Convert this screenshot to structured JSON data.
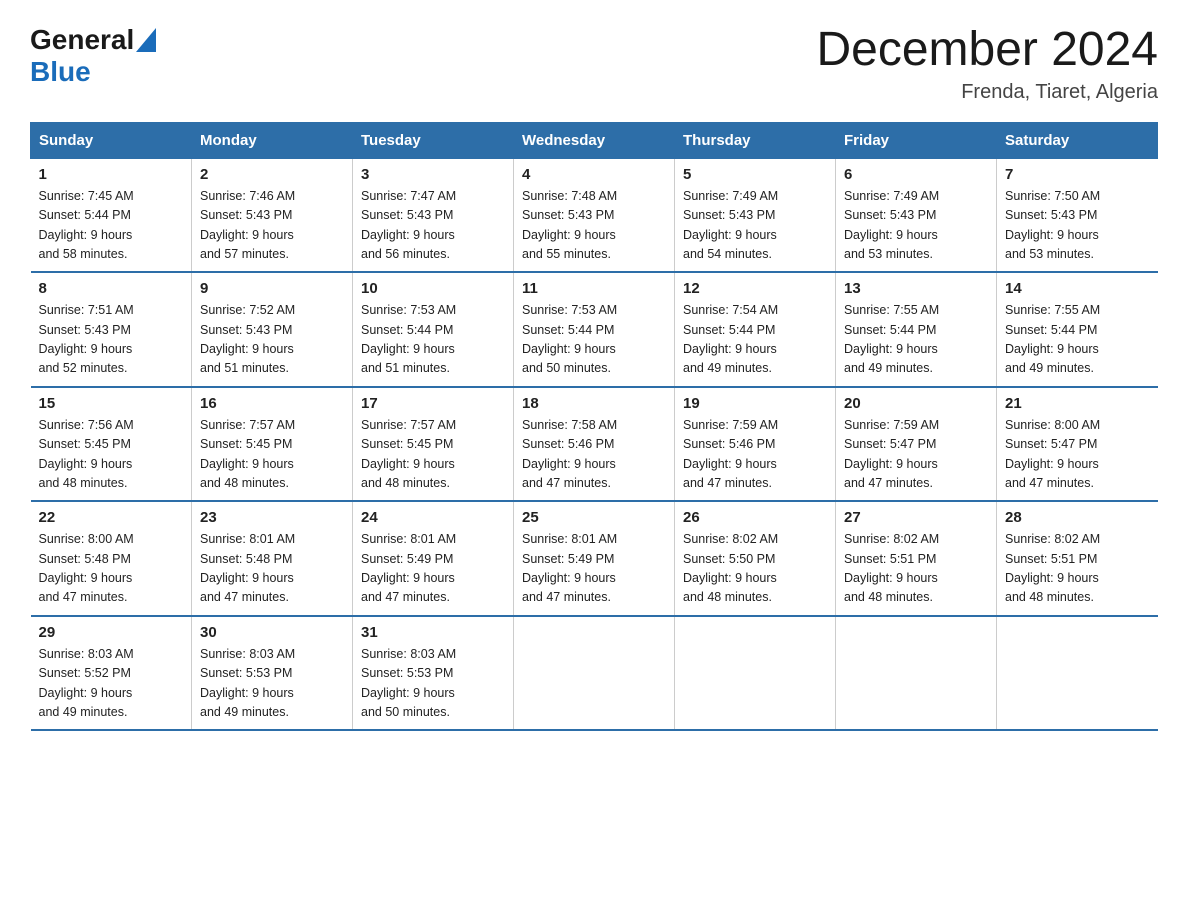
{
  "header": {
    "logo_general": "General",
    "logo_blue": "Blue",
    "month_title": "December 2024",
    "location": "Frenda, Tiaret, Algeria"
  },
  "days_of_week": [
    "Sunday",
    "Monday",
    "Tuesday",
    "Wednesday",
    "Thursday",
    "Friday",
    "Saturday"
  ],
  "weeks": [
    [
      {
        "day": "1",
        "sunrise": "Sunrise: 7:45 AM",
        "sunset": "Sunset: 5:44 PM",
        "daylight": "Daylight: 9 hours",
        "daylight2": "and 58 minutes."
      },
      {
        "day": "2",
        "sunrise": "Sunrise: 7:46 AM",
        "sunset": "Sunset: 5:43 PM",
        "daylight": "Daylight: 9 hours",
        "daylight2": "and 57 minutes."
      },
      {
        "day": "3",
        "sunrise": "Sunrise: 7:47 AM",
        "sunset": "Sunset: 5:43 PM",
        "daylight": "Daylight: 9 hours",
        "daylight2": "and 56 minutes."
      },
      {
        "day": "4",
        "sunrise": "Sunrise: 7:48 AM",
        "sunset": "Sunset: 5:43 PM",
        "daylight": "Daylight: 9 hours",
        "daylight2": "and 55 minutes."
      },
      {
        "day": "5",
        "sunrise": "Sunrise: 7:49 AM",
        "sunset": "Sunset: 5:43 PM",
        "daylight": "Daylight: 9 hours",
        "daylight2": "and 54 minutes."
      },
      {
        "day": "6",
        "sunrise": "Sunrise: 7:49 AM",
        "sunset": "Sunset: 5:43 PM",
        "daylight": "Daylight: 9 hours",
        "daylight2": "and 53 minutes."
      },
      {
        "day": "7",
        "sunrise": "Sunrise: 7:50 AM",
        "sunset": "Sunset: 5:43 PM",
        "daylight": "Daylight: 9 hours",
        "daylight2": "and 53 minutes."
      }
    ],
    [
      {
        "day": "8",
        "sunrise": "Sunrise: 7:51 AM",
        "sunset": "Sunset: 5:43 PM",
        "daylight": "Daylight: 9 hours",
        "daylight2": "and 52 minutes."
      },
      {
        "day": "9",
        "sunrise": "Sunrise: 7:52 AM",
        "sunset": "Sunset: 5:43 PM",
        "daylight": "Daylight: 9 hours",
        "daylight2": "and 51 minutes."
      },
      {
        "day": "10",
        "sunrise": "Sunrise: 7:53 AM",
        "sunset": "Sunset: 5:44 PM",
        "daylight": "Daylight: 9 hours",
        "daylight2": "and 51 minutes."
      },
      {
        "day": "11",
        "sunrise": "Sunrise: 7:53 AM",
        "sunset": "Sunset: 5:44 PM",
        "daylight": "Daylight: 9 hours",
        "daylight2": "and 50 minutes."
      },
      {
        "day": "12",
        "sunrise": "Sunrise: 7:54 AM",
        "sunset": "Sunset: 5:44 PM",
        "daylight": "Daylight: 9 hours",
        "daylight2": "and 49 minutes."
      },
      {
        "day": "13",
        "sunrise": "Sunrise: 7:55 AM",
        "sunset": "Sunset: 5:44 PM",
        "daylight": "Daylight: 9 hours",
        "daylight2": "and 49 minutes."
      },
      {
        "day": "14",
        "sunrise": "Sunrise: 7:55 AM",
        "sunset": "Sunset: 5:44 PM",
        "daylight": "Daylight: 9 hours",
        "daylight2": "and 49 minutes."
      }
    ],
    [
      {
        "day": "15",
        "sunrise": "Sunrise: 7:56 AM",
        "sunset": "Sunset: 5:45 PM",
        "daylight": "Daylight: 9 hours",
        "daylight2": "and 48 minutes."
      },
      {
        "day": "16",
        "sunrise": "Sunrise: 7:57 AM",
        "sunset": "Sunset: 5:45 PM",
        "daylight": "Daylight: 9 hours",
        "daylight2": "and 48 minutes."
      },
      {
        "day": "17",
        "sunrise": "Sunrise: 7:57 AM",
        "sunset": "Sunset: 5:45 PM",
        "daylight": "Daylight: 9 hours",
        "daylight2": "and 48 minutes."
      },
      {
        "day": "18",
        "sunrise": "Sunrise: 7:58 AM",
        "sunset": "Sunset: 5:46 PM",
        "daylight": "Daylight: 9 hours",
        "daylight2": "and 47 minutes."
      },
      {
        "day": "19",
        "sunrise": "Sunrise: 7:59 AM",
        "sunset": "Sunset: 5:46 PM",
        "daylight": "Daylight: 9 hours",
        "daylight2": "and 47 minutes."
      },
      {
        "day": "20",
        "sunrise": "Sunrise: 7:59 AM",
        "sunset": "Sunset: 5:47 PM",
        "daylight": "Daylight: 9 hours",
        "daylight2": "and 47 minutes."
      },
      {
        "day": "21",
        "sunrise": "Sunrise: 8:00 AM",
        "sunset": "Sunset: 5:47 PM",
        "daylight": "Daylight: 9 hours",
        "daylight2": "and 47 minutes."
      }
    ],
    [
      {
        "day": "22",
        "sunrise": "Sunrise: 8:00 AM",
        "sunset": "Sunset: 5:48 PM",
        "daylight": "Daylight: 9 hours",
        "daylight2": "and 47 minutes."
      },
      {
        "day": "23",
        "sunrise": "Sunrise: 8:01 AM",
        "sunset": "Sunset: 5:48 PM",
        "daylight": "Daylight: 9 hours",
        "daylight2": "and 47 minutes."
      },
      {
        "day": "24",
        "sunrise": "Sunrise: 8:01 AM",
        "sunset": "Sunset: 5:49 PM",
        "daylight": "Daylight: 9 hours",
        "daylight2": "and 47 minutes."
      },
      {
        "day": "25",
        "sunrise": "Sunrise: 8:01 AM",
        "sunset": "Sunset: 5:49 PM",
        "daylight": "Daylight: 9 hours",
        "daylight2": "and 47 minutes."
      },
      {
        "day": "26",
        "sunrise": "Sunrise: 8:02 AM",
        "sunset": "Sunset: 5:50 PM",
        "daylight": "Daylight: 9 hours",
        "daylight2": "and 48 minutes."
      },
      {
        "day": "27",
        "sunrise": "Sunrise: 8:02 AM",
        "sunset": "Sunset: 5:51 PM",
        "daylight": "Daylight: 9 hours",
        "daylight2": "and 48 minutes."
      },
      {
        "day": "28",
        "sunrise": "Sunrise: 8:02 AM",
        "sunset": "Sunset: 5:51 PM",
        "daylight": "Daylight: 9 hours",
        "daylight2": "and 48 minutes."
      }
    ],
    [
      {
        "day": "29",
        "sunrise": "Sunrise: 8:03 AM",
        "sunset": "Sunset: 5:52 PM",
        "daylight": "Daylight: 9 hours",
        "daylight2": "and 49 minutes."
      },
      {
        "day": "30",
        "sunrise": "Sunrise: 8:03 AM",
        "sunset": "Sunset: 5:53 PM",
        "daylight": "Daylight: 9 hours",
        "daylight2": "and 49 minutes."
      },
      {
        "day": "31",
        "sunrise": "Sunrise: 8:03 AM",
        "sunset": "Sunset: 5:53 PM",
        "daylight": "Daylight: 9 hours",
        "daylight2": "and 50 minutes."
      },
      null,
      null,
      null,
      null
    ]
  ]
}
